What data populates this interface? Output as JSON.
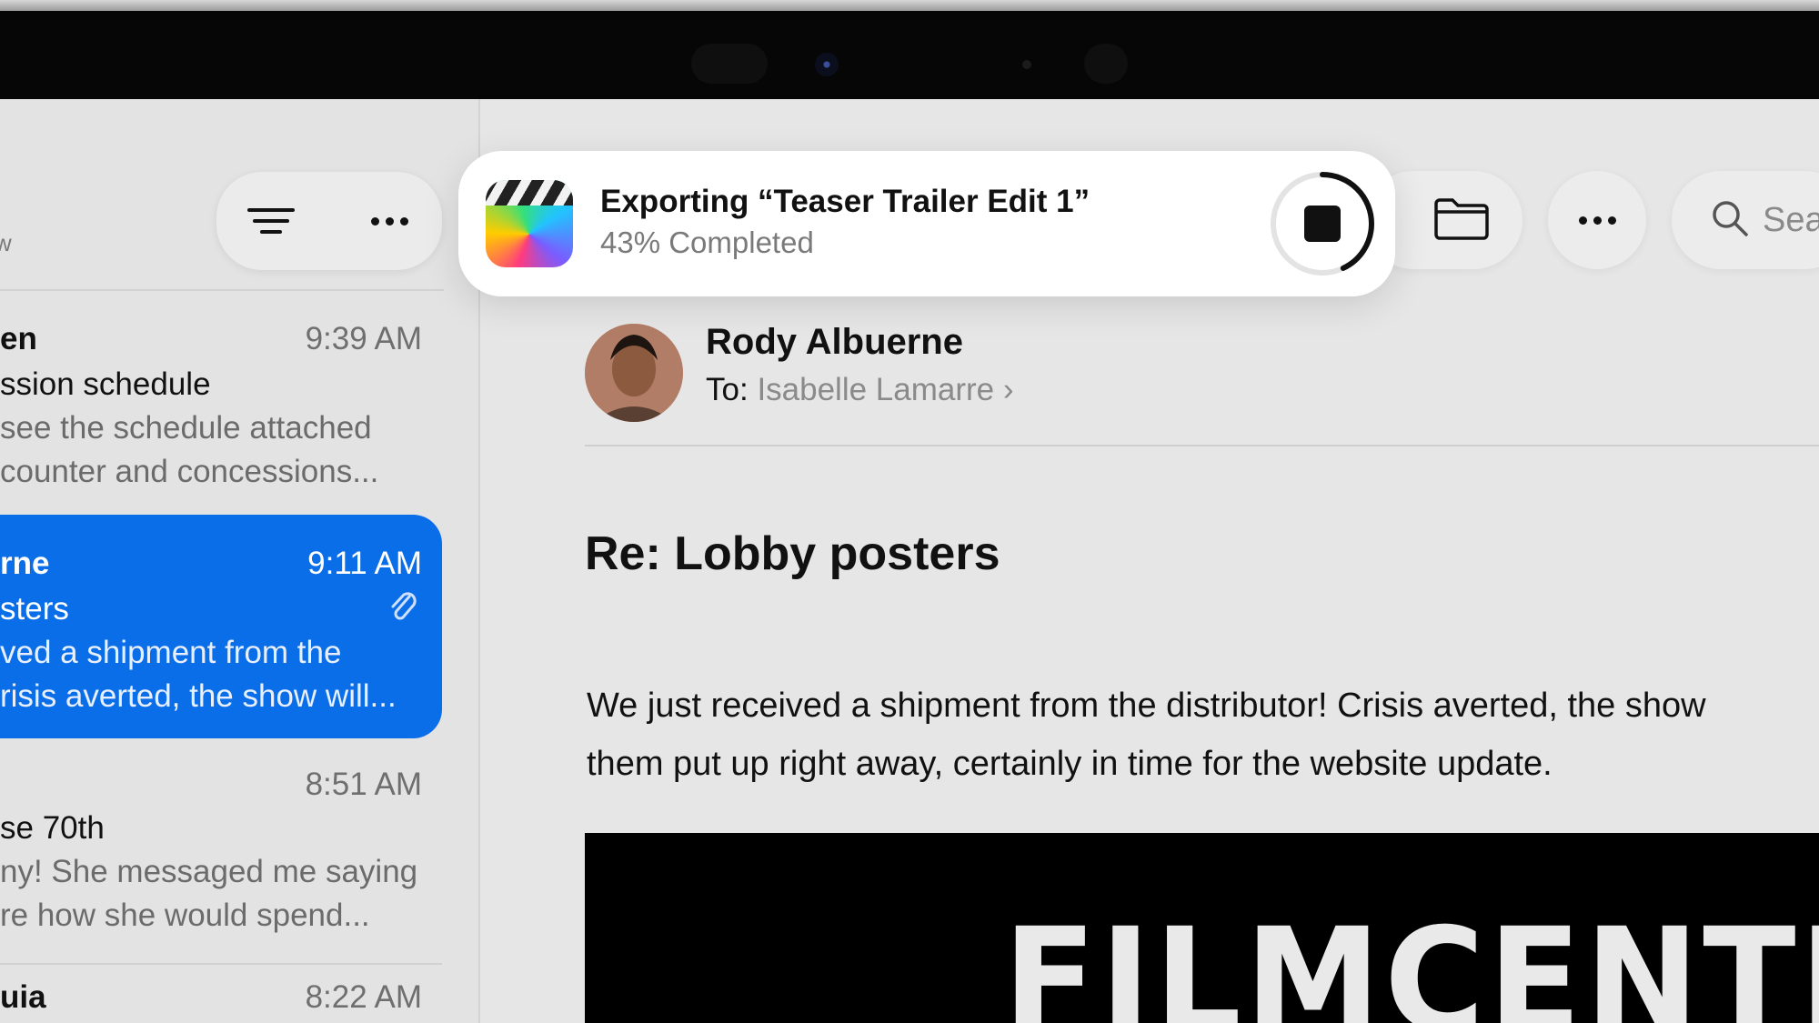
{
  "notification": {
    "title": "Exporting “Teaser Trailer Edit 1”",
    "subtitle": "43% Completed",
    "progress": 0.43,
    "app_icon": "final-cut-pro-icon",
    "stop_icon": "stop-icon"
  },
  "sidebar": {
    "toolbar": {
      "filter_icon": "filter-icon",
      "more_icon": "ellipsis-icon"
    },
    "fragment_letter": "w",
    "messages": [
      {
        "sender": "en",
        "time": "9:39 AM",
        "subject": "ssion schedule",
        "preview1": "see the schedule attached",
        "preview2": "counter and concessions...",
        "selected": false
      },
      {
        "sender": "rne",
        "time": "9:11 AM",
        "subject": "sters",
        "preview1": "ved a shipment from the",
        "preview2": "risis averted, the show will...",
        "selected": true,
        "attachment_icon": "paperclip-icon"
      },
      {
        "sender": "",
        "time": "8:51 AM",
        "subject": "se 70th",
        "preview1": "ny! She messaged me saying",
        "preview2": "re how she would spend...",
        "selected": false
      },
      {
        "sender": "uia",
        "time": "8:22 AM",
        "subject": "",
        "preview1": "",
        "preview2": "",
        "selected": false
      }
    ]
  },
  "header": {
    "folder_icon": "folder-icon",
    "more_icon": "ellipsis-icon",
    "search_icon": "search-icon",
    "search_placeholder": "Sea"
  },
  "message": {
    "sender": "Rody Albuerne",
    "to_label": "To:",
    "to_name": "Isabelle Lamarre",
    "chevron": "›",
    "subject": "Re: Lobby posters",
    "body_line1": "We just received a shipment from the distributor! Crisis averted, the show",
    "body_line2": "them put up right away, certainly in time for the website update.",
    "poster_text": "FILMCENTER"
  },
  "colors": {
    "accent": "#0A6EE8",
    "background": "#E6E6E6"
  }
}
